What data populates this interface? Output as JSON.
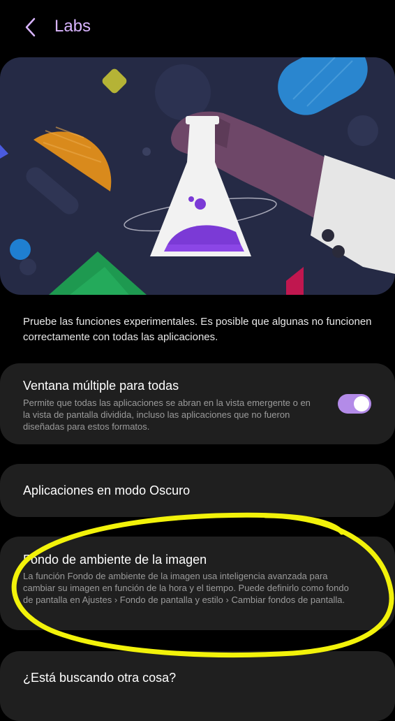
{
  "header": {
    "title": "Labs",
    "back_icon": "chevron-left-icon"
  },
  "intro": "Pruebe las funciones experimentales. Es posible que algunas no funcionen correctamente con todas las aplicaciones.",
  "items": [
    {
      "title": "Ventana múltiple para todas",
      "description": "Permite que todas las aplicaciones se abran en la vista emergente o en la vista de pantalla dividida, incluso las aplicaciones que no fueron diseñadas para estos formatos.",
      "toggle_on": true
    },
    {
      "title": "Aplicaciones en modo Oscuro"
    },
    {
      "title": "Fondo de ambiente de la imagen",
      "description": "La función Fondo de ambiente de la imagen usa inteligencia avanzada para cambiar su imagen en función de la hora y el tiempo. Puede definirlo como fondo de pantalla en Ajustes › Fondo de pantalla y estilo › Cambiar fondos de pantalla."
    },
    {
      "title": "¿Está buscando otra cosa?"
    }
  ],
  "colors": {
    "accent": "#b38be8",
    "title": "#d8b4fe",
    "card": "#1f1f1f",
    "hero_bg": "#252a45",
    "highlight": "#f2f20a"
  }
}
